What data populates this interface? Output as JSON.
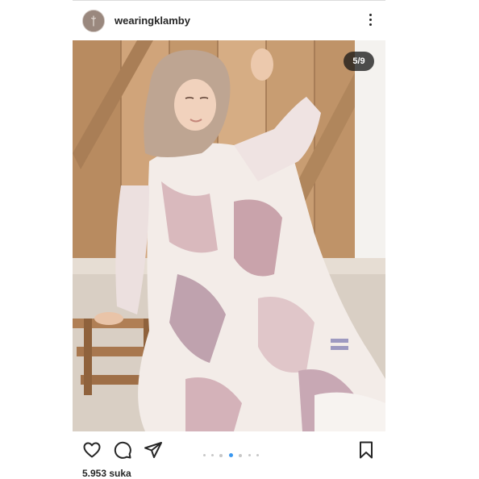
{
  "header": {
    "username": "wearingklamby",
    "avatar_icon": "brand-logo-icon",
    "more_icon": "more-vertical-icon"
  },
  "photo": {
    "counter": "5/9",
    "description_icon": "photo"
  },
  "actions": {
    "like_icon": "heart-icon",
    "comment_icon": "comment-icon",
    "share_icon": "send-icon",
    "save_icon": "bookmark-icon",
    "carousel": {
      "total": 9,
      "active": 5,
      "visible_dots": 7
    }
  },
  "likes": {
    "text": "5.953 suka"
  },
  "colors": {
    "accent": "#3897f0",
    "text": "#262626",
    "divider": "#dbdbdb"
  }
}
